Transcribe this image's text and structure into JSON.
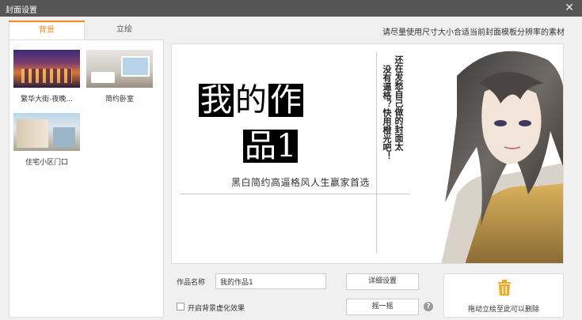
{
  "window": {
    "title": "封面设置",
    "close_glyph": "✕"
  },
  "tabs": [
    {
      "label": "背景",
      "active": true
    },
    {
      "label": "立绘",
      "active": false
    }
  ],
  "hint": "请尽量使用尺寸大小合适当前封面模板分辨率的素材",
  "backgrounds": [
    {
      "label": "繁华大街-夜晚..."
    },
    {
      "label": "简约卧室"
    },
    {
      "label": "住宅小区门口"
    }
  ],
  "preview": {
    "title_chars": [
      "我",
      "的",
      "作",
      "品1"
    ],
    "subtitle": "黑白简约高逼格风人生赢家首选",
    "vertical_text": [
      "还在发愁自己做的封面太",
      "没有逼格？快用橙光吧！"
    ]
  },
  "form": {
    "name_label": "作品名称",
    "name_value": "我的作品1",
    "detail_button": "详细设置",
    "blur_label": "开启背景虚化效果",
    "shake_button": "摇一摇",
    "help_glyph": "?",
    "delete_hint": "拖动立绘至此可以删除"
  },
  "colors": {
    "accent": "#f08a24",
    "titlebar": "#565656",
    "trash": "#f5a623"
  },
  "icons": {
    "close": "close-icon",
    "help": "help-icon",
    "trash": "trash-icon"
  }
}
